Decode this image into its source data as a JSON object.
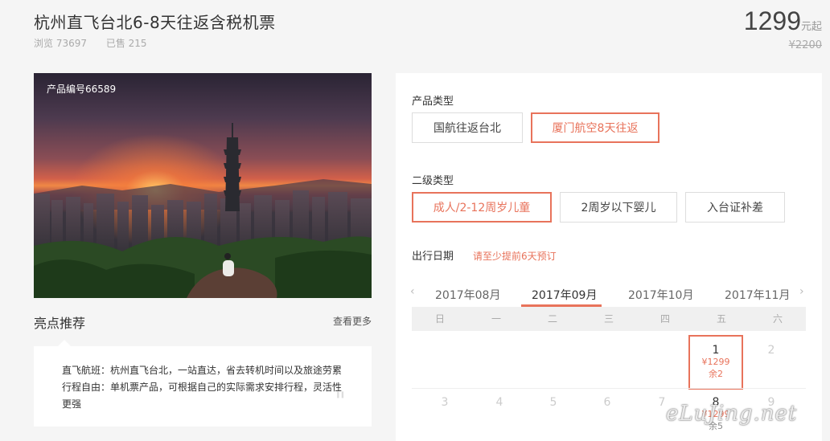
{
  "product": {
    "title": "杭州直飞台北6-8天往返含税机票",
    "views_label": "浏览 73697",
    "sold_label": "已售 215",
    "price": "1299",
    "price_unit": "元起",
    "original_price": "¥2200",
    "code": "产品编号66589"
  },
  "highlights": {
    "title": "亮点推荐",
    "more": "查看更多",
    "text": "直飞航班：杭州直飞台北，一站直达，省去转机时间以及旅途劳累行程自由：单机票产品，可根据自己的实际需求安排行程，灵活性更强",
    "quote": "\""
  },
  "options": {
    "type_label": "产品类型",
    "types": [
      "国航往返台北",
      "厦门航空8天往返"
    ],
    "sub_label": "二级类型",
    "subs": [
      "成人/2-12周岁儿童",
      "2周岁以下婴儿",
      "入台证补差"
    ],
    "date_label": "出行日期",
    "date_notice": "请至少提前6天预订"
  },
  "calendar": {
    "prev": "‹",
    "next": "›",
    "months": [
      "2017年08月",
      "2017年09月",
      "2017年10月",
      "2017年11月"
    ],
    "weekdays": [
      "日",
      "一",
      "二",
      "三",
      "四",
      "五",
      "六"
    ],
    "day1": {
      "date": "1",
      "price": "¥1299",
      "remain": "余2"
    },
    "day2": {
      "date": "2"
    },
    "row2": [
      "3",
      "4",
      "5",
      "6",
      "7",
      "8",
      "9"
    ],
    "day8": {
      "price": "¥1299",
      "remain": "余5"
    }
  },
  "colors": {
    "accent": "#e8735b"
  },
  "watermark": "eLuJing.net"
}
